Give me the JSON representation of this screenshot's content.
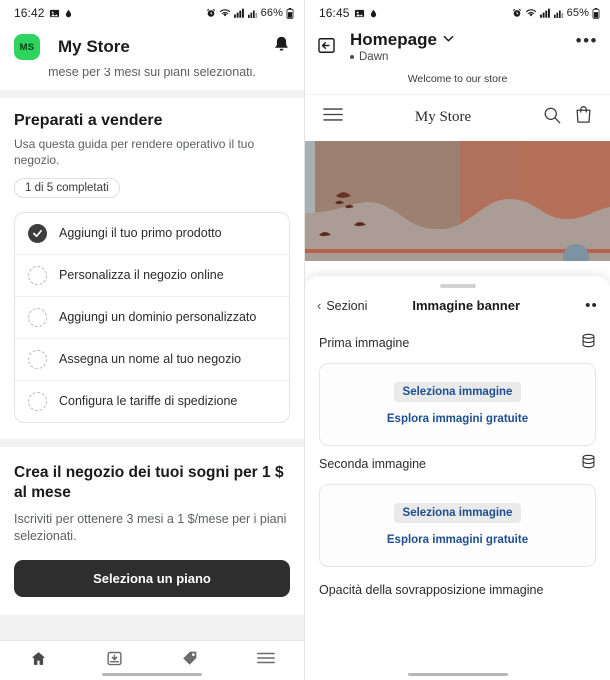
{
  "left": {
    "status_bar": {
      "time": "16:42",
      "battery": "66%",
      "icons": [
        "image-icon",
        "droplet-icon",
        "alarm-icon",
        "wifi-icon",
        "signal-icon",
        "signal-icon-2",
        "battery-icon"
      ]
    },
    "header": {
      "avatar_initials": "MS",
      "title": "My Store",
      "bell": "notification-bell-icon"
    },
    "clipped_text": "mese per 3 mesi sui piani selezionati.",
    "guide": {
      "title": "Preparati a vendere",
      "subtitle": "Usa questa guida per rendere operativo il tuo negozio.",
      "progress_badge": "1 di 5 completati",
      "items": [
        {
          "label": "Aggiungi il tuo primo prodotto",
          "done": true
        },
        {
          "label": "Personalizza il negozio online",
          "done": false
        },
        {
          "label": "Aggiungi un dominio personalizzato",
          "done": false
        },
        {
          "label": "Assegna un nome al tuo negozio",
          "done": false
        },
        {
          "label": "Configura le tariffe di spedizione",
          "done": false
        }
      ]
    },
    "promo": {
      "title": "Crea il negozio dei tuoi sogni per 1 $ al mese",
      "subtitle": "Iscriviti per ottenere 3 mesi a 1 $/mese per i piani selezionati.",
      "button_label": "Seleziona un piano"
    },
    "bottom_nav": [
      {
        "name": "home-icon"
      },
      {
        "name": "orders-inbox-icon"
      },
      {
        "name": "products-tag-icon"
      },
      {
        "name": "menu-hamburger-icon"
      }
    ]
  },
  "right": {
    "status_bar": {
      "time": "16:45",
      "battery": "65%"
    },
    "editor_header": {
      "exit_icon": "exit-icon",
      "page_title": "Homepage",
      "chevron": "chevron-down-icon",
      "theme_name": "Dawn",
      "more_label": "•••"
    },
    "preview": {
      "announcement": "Welcome to our store",
      "store_name": "My Store",
      "icons": [
        "menu-hamburger-icon",
        "search-icon",
        "cart-icon"
      ]
    },
    "sheet": {
      "back_label": "Sezioni",
      "title": "Immagine banner",
      "more_label": "••",
      "fields": [
        {
          "label": "Prima immagine",
          "select_label": "Seleziona immagine",
          "explore_label": "Esplora immagini gratuite"
        },
        {
          "label": "Seconda immagine",
          "select_label": "Seleziona immagine",
          "explore_label": "Esplora immagini gratuite"
        }
      ],
      "opacity_label": "Opacità della sovrapposizione immagine"
    }
  },
  "colors": {
    "accent_green": "#2fd45e",
    "link_blue": "#1d4f91",
    "dark_button": "#2e2e2e"
  }
}
